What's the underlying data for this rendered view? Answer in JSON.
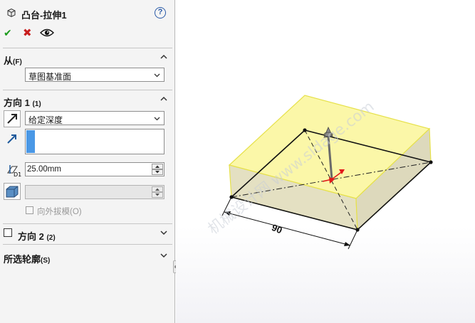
{
  "feature": {
    "title": "凸台-拉伸1",
    "help_glyph": "?",
    "ok_glyph": "✔",
    "cancel_glyph": "✖"
  },
  "from": {
    "title": "从",
    "key": "(F)",
    "value": "草图基准面"
  },
  "direction1": {
    "title": "方向 1",
    "key": "(1)",
    "end_condition": "给定深度",
    "depth": "25.00mm",
    "draft_label": "向外拔模",
    "draft_key": "(O)"
  },
  "direction2": {
    "title": "方向 2",
    "key": "(2)"
  },
  "contours": {
    "title": "所选轮廓",
    "key": "(S)"
  },
  "viewport": {
    "dimension": "90",
    "watermark": "机械设计网 www.sldage.com",
    "colors": {
      "face_yellow": "#fbf7a8",
      "edge_yellow": "#e6e14a",
      "side_face": "#e4e0c2",
      "arrow_red": "#e21a1a"
    }
  },
  "icons": [
    "part-feature-icon",
    "help-icon",
    "ok-icon",
    "cancel-icon",
    "preview-eye-icon",
    "reverse-direction-icon",
    "direction-vector-icon",
    "depth-icon",
    "draft-icon",
    "collapse-chevron-icon",
    "dropdown-arrow-icon"
  ]
}
